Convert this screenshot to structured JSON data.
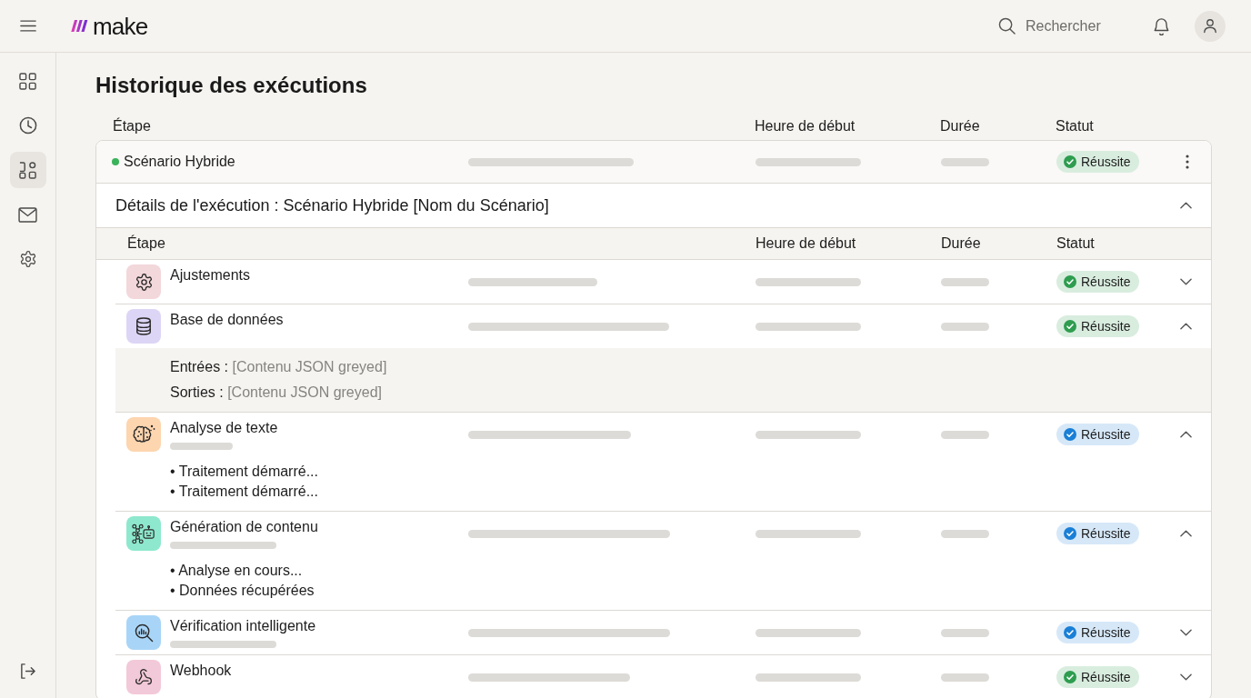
{
  "header": {
    "logo": "make",
    "search": {
      "placeholder": "Rechercher"
    }
  },
  "sidebar": {
    "items": [
      {
        "kind": "dashboard",
        "selected": false
      },
      {
        "kind": "history",
        "selected": false
      },
      {
        "kind": "scenarios",
        "selected": true
      },
      {
        "kind": "mail",
        "selected": false
      },
      {
        "kind": "settings",
        "selected": false
      }
    ]
  },
  "page": {
    "title": "Historique des exécutions"
  },
  "table": {
    "columns": [
      "Étape",
      "Heure de début",
      "Durée",
      "Statut"
    ],
    "scenario": {
      "name": "Scénario Hybride",
      "active": true,
      "status": {
        "label": "Réussite",
        "color": "#2e9d4f"
      }
    },
    "details": {
      "title": "Détails de l'exécution : Scénario Hybride [Nom du Scénario]",
      "expanded": true,
      "columns": [
        "Étape",
        "Heure de début",
        "Durée",
        "Statut"
      ],
      "steps": [
        {
          "name": "Ajustements",
          "kind": "tool",
          "color": "#f2d7db",
          "subtitle_placeholder": false,
          "status": {
            "label": "Réussite",
            "color": "#2e9d4f"
          },
          "expanded": false
        },
        {
          "name": "Base de données",
          "kind": "datastore",
          "color": "#ddd5f5",
          "subtitle_placeholder": false,
          "status": {
            "label": "Réussite",
            "color": "#2e9d4f"
          },
          "expanded": true,
          "details": {
            "kind": "io",
            "entries": [
              {
                "label": "Entrées :",
                "value": "[Contenu JSON greyed]"
              },
              {
                "label": "Sorties :",
                "value": "[Contenu JSON greyed]"
              }
            ]
          }
        },
        {
          "name": "Analyse de texte",
          "kind": "text-ai",
          "color": "#fdd5af",
          "subtitle_placeholder": true,
          "status": {
            "label": "Réussite",
            "color": "#1a7fd6"
          },
          "expanded": true,
          "details": {
            "kind": "log",
            "lines": [
              "• Traitement démarré...",
              "• Traitement démarré..."
            ]
          }
        },
        {
          "name": "Génération de contenu",
          "kind": "agent",
          "color": "#8ee8cd",
          "subtitle_placeholder": true,
          "status": {
            "label": "Réussite",
            "color": "#1a7fd6"
          },
          "expanded": true,
          "details": {
            "kind": "log",
            "lines": [
              "• Analyse en cours...",
              "• Données récupérées"
            ]
          }
        },
        {
          "name": "Vérification intelligente",
          "kind": "inspect",
          "color": "#a8d5f7",
          "subtitle_placeholder": true,
          "status": {
            "label": "Réussite",
            "color": "#1a7fd6"
          },
          "expanded": false
        },
        {
          "name": "Webhook",
          "kind": "webhook",
          "color": "#f2c9d8",
          "subtitle_placeholder": false,
          "status": {
            "label": "Réussite",
            "color": "#2e9d4f"
          },
          "expanded": false
        }
      ]
    }
  }
}
